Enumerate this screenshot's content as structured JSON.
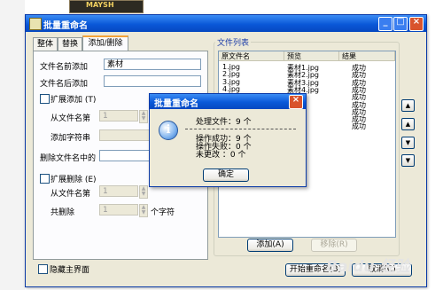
{
  "background": {
    "thumb_text": "MAYSH"
  },
  "window": {
    "title": "批量重命名",
    "title_buttons": [
      "_",
      "□",
      "×"
    ],
    "tabs": [
      "整体",
      "替换",
      "添加/删除"
    ],
    "active_tab": "添加/删除"
  },
  "form": {
    "prefix_label": "文件名前添加",
    "prefix_value": "素材",
    "suffix_label": "文件名后添加",
    "suffix_value": "",
    "ext_add_label": "扩展添加 (T)",
    "from_char_label": "从文件名第",
    "from_char_value": "1",
    "add_string_label": "添加字符串",
    "delete_label": "删除文件名中的",
    "ext_delete_label": "扩展删除 (E)",
    "from_char2_label": "从文件名第",
    "from_char2_value": "1",
    "total_delete_label": "共删除",
    "total_delete_value": "1",
    "unit_char": "个字符",
    "hide_main_label": "隐藏主界面"
  },
  "file_list": {
    "title": "文件列表",
    "columns": [
      "原文件名",
      "预览",
      "结果"
    ],
    "rows": [
      [
        "1.jpg",
        "素材1.jpg",
        "成功"
      ],
      [
        "2.jpg",
        "素材2.jpg",
        "成功"
      ],
      [
        "3.jpg",
        "素材3.jpg",
        "成功"
      ],
      [
        "4.jpg",
        "素材4.jpg",
        "成功"
      ],
      [
        "",
        "",
        "成功"
      ],
      [
        "",
        "",
        "成功"
      ],
      [
        "",
        "",
        "成功"
      ],
      [
        "",
        "",
        "成功"
      ],
      [
        "",
        "",
        "成功"
      ]
    ],
    "add_button": "添加(A)",
    "remove_button": "移除(R)",
    "side_buttons": [
      "▲",
      "▲",
      "▼",
      "▼"
    ]
  },
  "footer": {
    "start_button": "开始重命名(B)",
    "cancel_button": "取消(C)"
  },
  "dialog": {
    "title": "批量重命名",
    "processed": "处理文件：9 个",
    "success": "操作成功：9 个",
    "failed": "操作失败：0 个",
    "unchanged": "未更改    ：0 个",
    "ok_button": "确定"
  },
  "watermark": "Baidu 经验"
}
